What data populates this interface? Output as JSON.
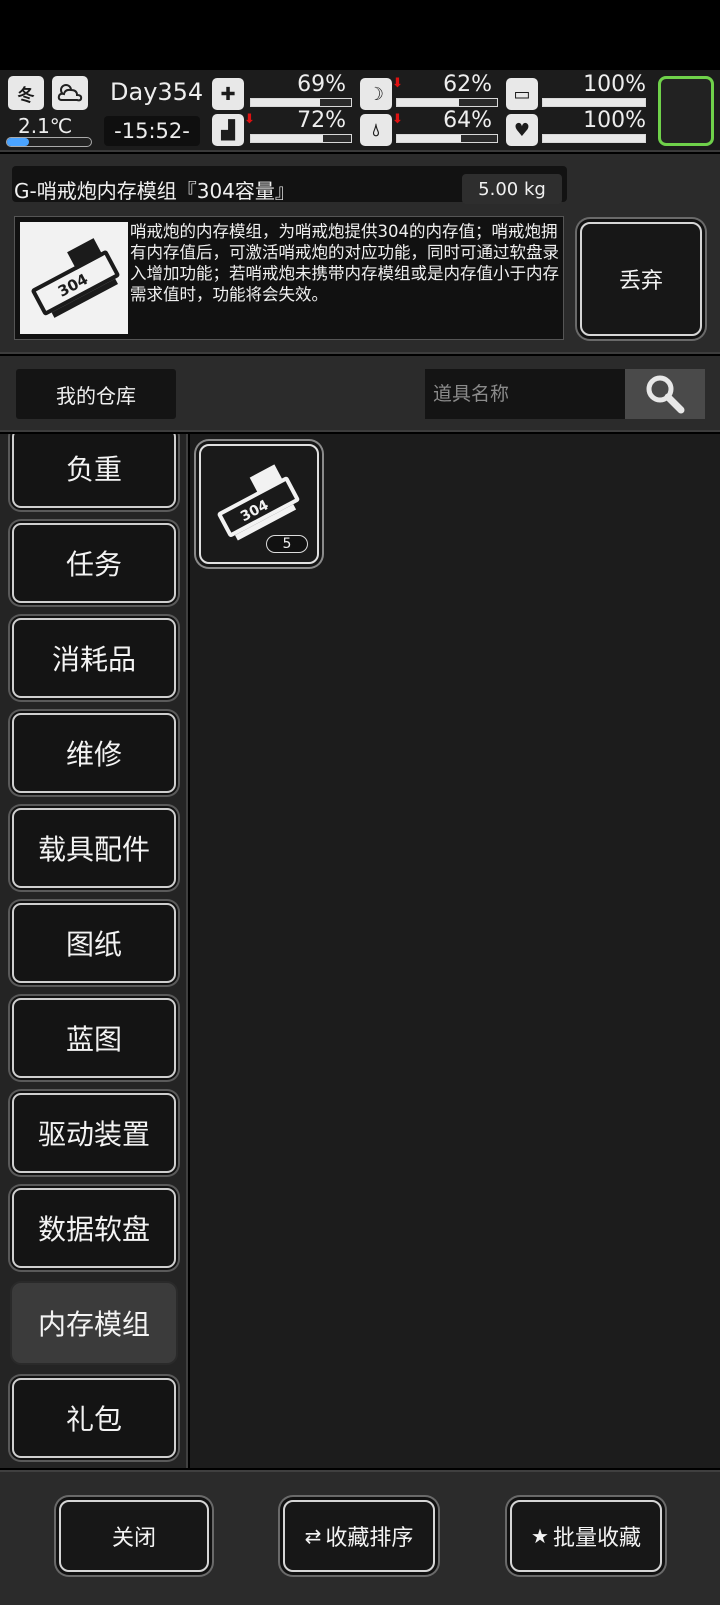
{
  "hud": {
    "season": "冬",
    "temperature": "2.1℃",
    "day": "Day354",
    "time": "-15:52-",
    "stats": [
      {
        "name": "health",
        "icon": "medkit-icon",
        "value": "69%",
        "fraction": 0.69,
        "decreasing": false
      },
      {
        "name": "hunger",
        "icon": "stomach-icon",
        "value": "62%",
        "fraction": 0.62,
        "decreasing": true
      },
      {
        "name": "energy",
        "icon": "battery-icon",
        "value": "100%",
        "fraction": 1.0,
        "decreasing": false
      },
      {
        "name": "stamina",
        "icon": "boot-icon",
        "value": "72%",
        "fraction": 0.72,
        "decreasing": true
      },
      {
        "name": "thirst",
        "icon": "water-drop-icon",
        "value": "64%",
        "fraction": 0.64,
        "decreasing": true
      },
      {
        "name": "mood",
        "icon": "heart-icon",
        "value": "100%",
        "fraction": 1.0,
        "decreasing": false
      }
    ]
  },
  "detail": {
    "title": "G-哨戒炮内存模组『304容量』",
    "weight": "5.00 kg",
    "description": "哨戒炮的内存模组，为哨戒炮提供304的内存值；哨戒炮拥有内存值后，可激活哨戒炮的对应功能，同时可通过软盘录入增加功能；若哨戒炮未携带内存模组或是内存值小于内存需求值时，功能将会失效。",
    "discard_label": "丢弃",
    "thumb_label": "304"
  },
  "warehouse": {
    "title": "我的仓库",
    "search_placeholder": "道具名称"
  },
  "categories": [
    {
      "label": "负重",
      "active": false
    },
    {
      "label": "任务",
      "active": false
    },
    {
      "label": "消耗品",
      "active": false
    },
    {
      "label": "维修",
      "active": false
    },
    {
      "label": "载具配件",
      "active": false
    },
    {
      "label": "图纸",
      "active": false
    },
    {
      "label": "蓝图",
      "active": false
    },
    {
      "label": "驱动装置",
      "active": false
    },
    {
      "label": "数据软盘",
      "active": false
    },
    {
      "label": "内存模组",
      "active": true
    },
    {
      "label": "礼包",
      "active": false
    }
  ],
  "items": [
    {
      "label": "304",
      "count": "5"
    }
  ],
  "bottom": {
    "close_label": "关闭",
    "sort_label": "收藏排序",
    "batch_label": "批量收藏"
  },
  "colors": {
    "panel": "#2b2b2b",
    "dark": "#141414",
    "accent_green": "#6fd14a",
    "alert_red": "#d11111"
  }
}
